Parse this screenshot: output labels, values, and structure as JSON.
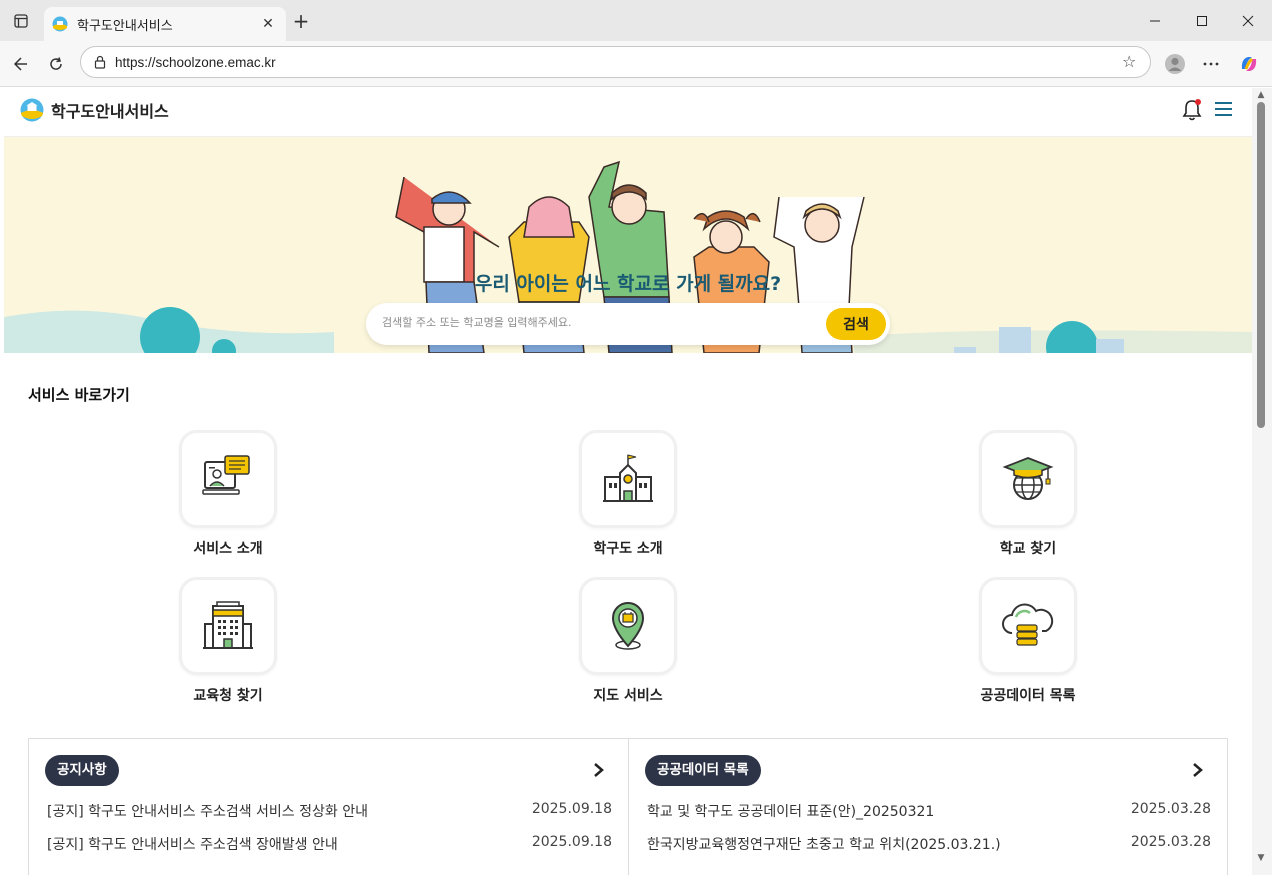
{
  "browser": {
    "tab_title": "학구도안내서비스",
    "url": "https://schoolzone.emac.kr"
  },
  "site": {
    "logo_text": "학구도안내서비스"
  },
  "hero": {
    "title": "우리 아이는 어느 학교로 가게 될까요?",
    "search_placeholder": "검색할 주소 또는 학교명을 입력해주세요.",
    "search_button": "검색"
  },
  "services": {
    "heading": "서비스 바로가기",
    "items": [
      {
        "label": "서비스 소개",
        "icon": "presentation-icon"
      },
      {
        "label": "학구도 소개",
        "icon": "school-building-icon"
      },
      {
        "label": "학교 찾기",
        "icon": "graduation-globe-icon"
      },
      {
        "label": "교육청 찾기",
        "icon": "office-building-icon"
      },
      {
        "label": "지도 서비스",
        "icon": "map-pin-icon"
      },
      {
        "label": "공공데이터 목록",
        "icon": "cloud-database-icon"
      }
    ]
  },
  "notices": {
    "title": "공지사항",
    "items": [
      {
        "text": "[공지] 학구도 안내서비스 주소검색 서비스 정상화 안내",
        "date": "2025.09.18"
      },
      {
        "text": "[공지] 학구도 안내서비스 주소검색 장애발생 안내",
        "date": "2025.09.18"
      }
    ]
  },
  "public_data": {
    "title": "공공데이터 목록",
    "items": [
      {
        "text": "학교 및 학구도 공공데이터 표준(안)_20250321",
        "date": "2025.03.28"
      },
      {
        "text": "한국지방교육행정연구재단 초중고 학교 위치(2025.03.21.)",
        "date": "2025.03.28"
      }
    ]
  },
  "colors": {
    "hero_bg": "#fcf7dc",
    "accent_yellow": "#f5c400",
    "title_teal": "#1a5b73",
    "pill_dark": "#2e3447"
  }
}
